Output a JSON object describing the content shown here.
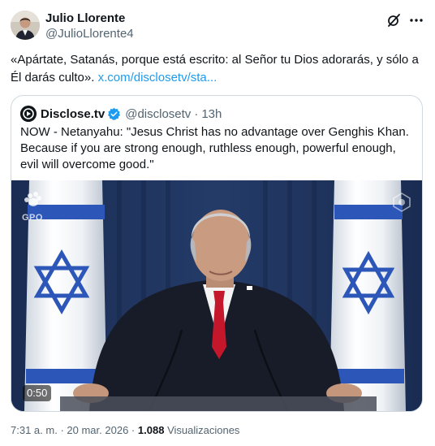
{
  "author": {
    "name": "Julio Llorente",
    "handle": "@JulioLlorente4"
  },
  "tweet": {
    "text": "«Apártate, Satanás, porque está escrito: al Señor tu Dios adorarás, y sólo a Él darás culto». ",
    "link_text": "x.com/disclosetv/sta..."
  },
  "quote": {
    "name": "Disclose.tv",
    "handle": "@disclosetv",
    "separator": "·",
    "time": "13h",
    "text": "NOW - Netanyahu: \"Jesus Christ has no advantage over Genghis Khan. Because if you are strong enough, ruthless enough, powerful enough, evil will overcome good.\"",
    "video_duration": "0:50",
    "video_watermark": "GPO"
  },
  "meta": {
    "time": "7:31 a. m.",
    "separator": "·",
    "date": "20 mar. 2026",
    "views_count": "1.088",
    "views_label": "Visualizaciones"
  },
  "colors": {
    "link": "#1d9bf0",
    "verified": "#1d9bf0",
    "border": "#cfd9de",
    "secondary_text": "#536471"
  },
  "icons": [
    "grok-icon",
    "more-icon",
    "verified-icon",
    "gpo-logo",
    "watermark-logo"
  ]
}
